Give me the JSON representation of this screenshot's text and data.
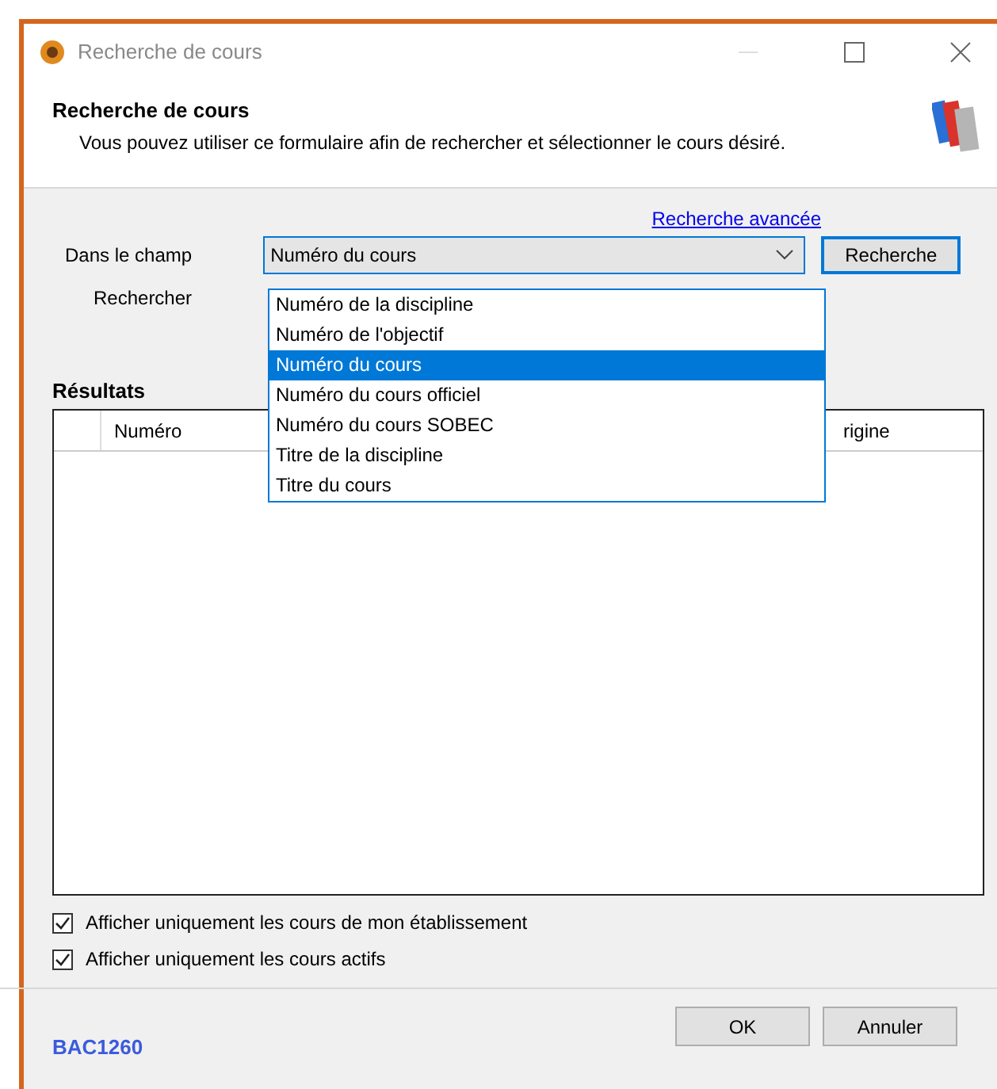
{
  "window": {
    "title": "Recherche de cours"
  },
  "header": {
    "title": "Recherche de cours",
    "subtitle": "Vous pouvez utiliser ce formulaire afin de rechercher et sélectionner le cours désiré."
  },
  "advanced_link": "Recherche avancée",
  "field_label": "Dans le champ",
  "field_combo": {
    "value": "Numéro du cours",
    "expanded": true,
    "options": [
      {
        "label": "Numéro de la discipline",
        "selected": false
      },
      {
        "label": "Numéro de l'objectif",
        "selected": false
      },
      {
        "label": "Numéro du cours",
        "selected": true
      },
      {
        "label": "Numéro du cours officiel",
        "selected": false
      },
      {
        "label": "Numéro du cours SOBEC",
        "selected": false
      },
      {
        "label": "Titre de la discipline",
        "selected": false
      },
      {
        "label": "Titre du cours",
        "selected": false
      }
    ]
  },
  "search_button": "Recherche",
  "search_label": "Rechercher",
  "results": {
    "title": "Résultats",
    "columns": [
      {
        "label": "Numéro"
      },
      {
        "label": "rigine"
      }
    ]
  },
  "checkboxes": [
    {
      "label": "Afficher uniquement les cours de mon établissement",
      "checked": true
    },
    {
      "label": "Afficher uniquement les cours actifs",
      "checked": true
    }
  ],
  "footer": {
    "code": "BAC1260",
    "buttons": [
      "OK",
      "Annuler"
    ]
  }
}
